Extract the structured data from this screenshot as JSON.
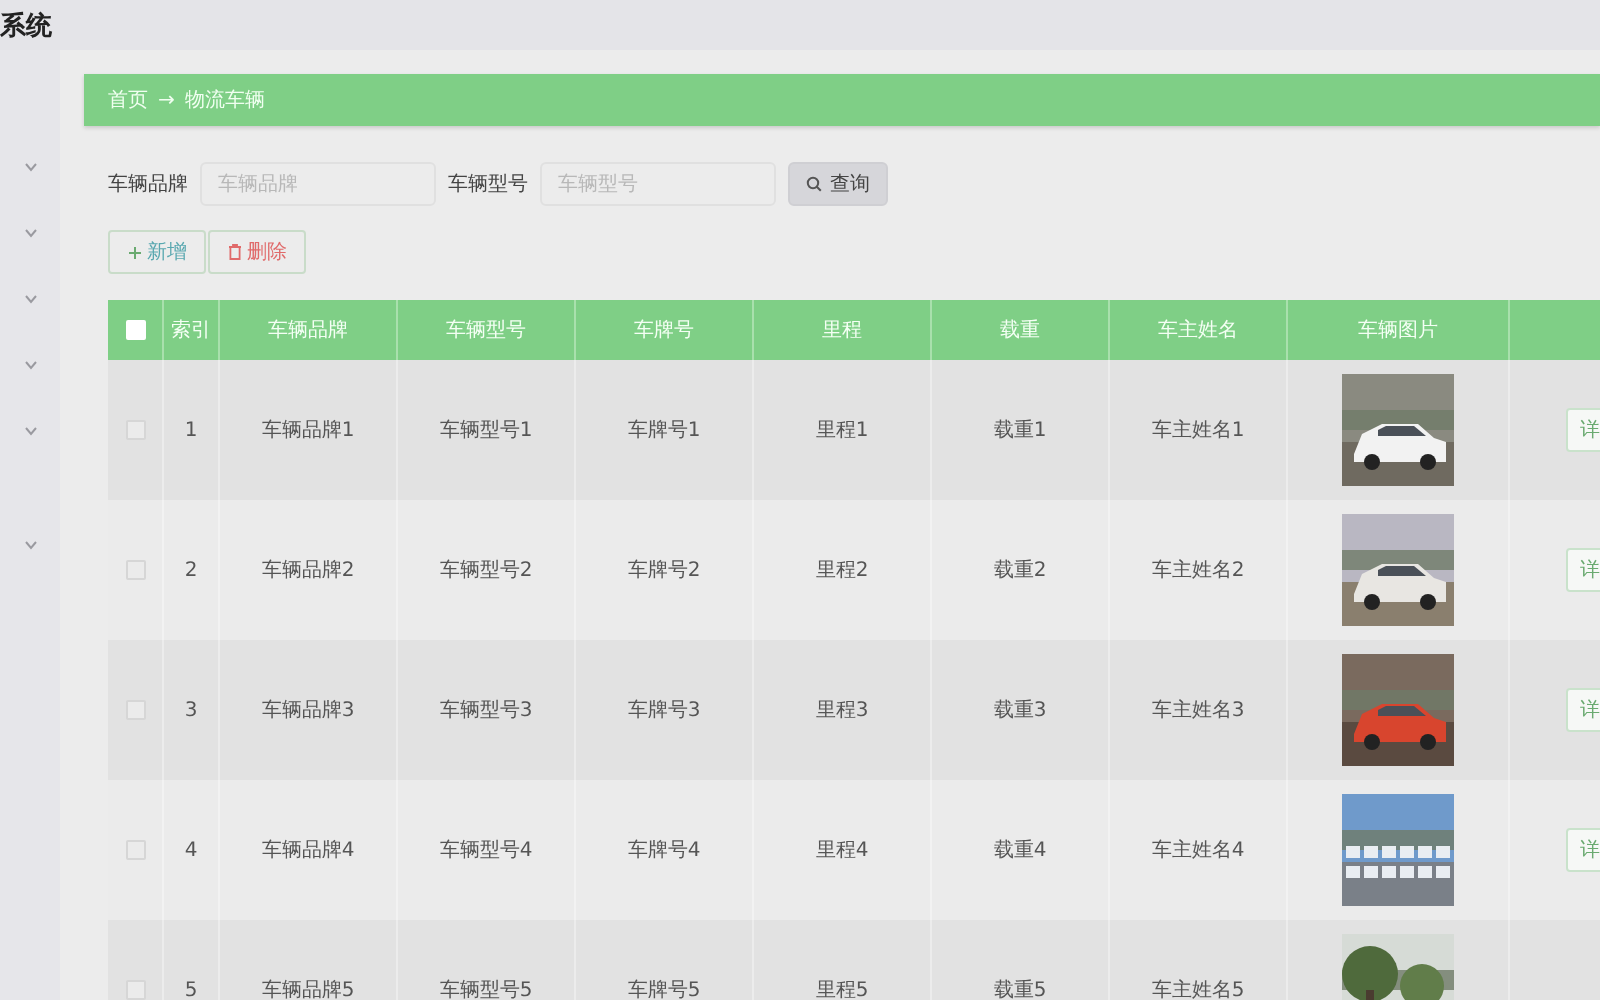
{
  "app": {
    "title": "系统"
  },
  "sidebar": {
    "items": [
      {
        "expanded": false
      },
      {
        "expanded": false
      },
      {
        "expanded": false
      },
      {
        "expanded": false
      },
      {
        "expanded": false
      },
      {
        "expanded": false
      }
    ]
  },
  "breadcrumb": {
    "home": "首页",
    "separator": "→",
    "current": "物流车辆"
  },
  "search": {
    "fields": [
      {
        "label": "车辆品牌",
        "placeholder": "车辆品牌"
      },
      {
        "label": "车辆型号",
        "placeholder": "车辆型号"
      }
    ],
    "button": "查询"
  },
  "actions": {
    "add": "新增",
    "delete": "删除"
  },
  "table": {
    "header_checked": false,
    "columns": [
      "索引",
      "车辆品牌",
      "车辆型号",
      "车牌号",
      "里程",
      "载重",
      "车主姓名",
      "车辆图片"
    ],
    "rows": [
      {
        "checked": false,
        "cells": [
          "1",
          "车辆品牌1",
          "车辆型号1",
          "车牌号1",
          "里程1",
          "载重1",
          "车主姓名1"
        ],
        "image": {
          "kind": "picture"
        },
        "action": "详"
      },
      {
        "checked": false,
        "cells": [
          "2",
          "车辆品牌2",
          "车辆型号2",
          "车牌号2",
          "里程2",
          "载重2",
          "车主姓名2"
        ],
        "image": {
          "kind": "picture"
        },
        "action": "详"
      },
      {
        "checked": false,
        "cells": [
          "3",
          "车辆品牌3",
          "车辆型号3",
          "车牌号3",
          "里程3",
          "载重3",
          "车主姓名3"
        ],
        "image": {
          "kind": "picture"
        },
        "action": "详"
      },
      {
        "checked": false,
        "cells": [
          "4",
          "车辆品牌4",
          "车辆型号4",
          "车牌号4",
          "里程4",
          "载重4",
          "车主姓名4"
        ],
        "image": {
          "kind": "picture"
        },
        "action": "详"
      },
      {
        "checked": false,
        "cells": [
          "5",
          "车辆品牌5",
          "车辆型号5",
          "车牌号5",
          "里程5",
          "载重5",
          "车主姓名5"
        ],
        "image": {
          "kind": "picture"
        }
      }
    ]
  }
}
